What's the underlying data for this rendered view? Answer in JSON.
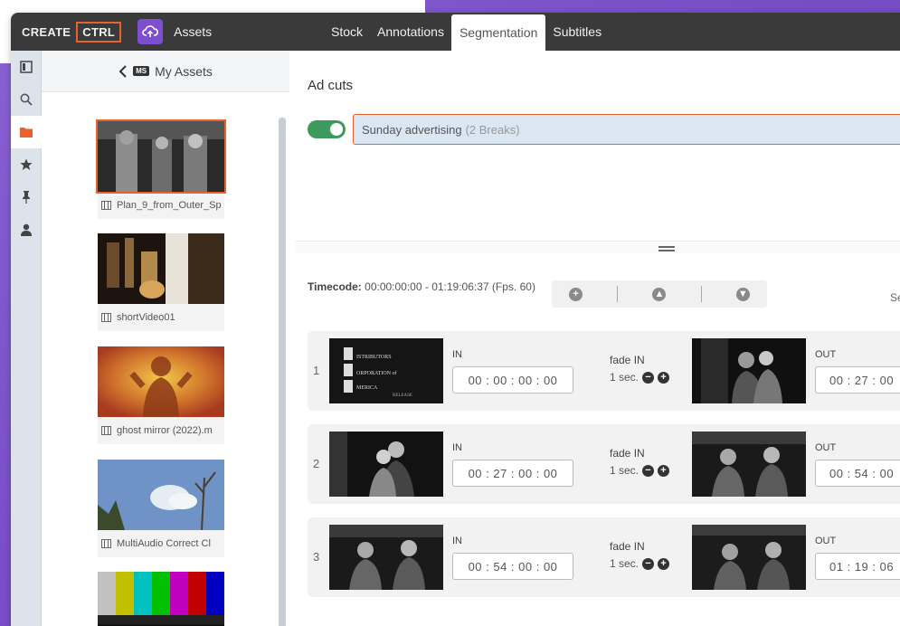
{
  "brand": {
    "create": "CREATE",
    "ctrl": "CTRL"
  },
  "topbar": {
    "assets_label": "Assets"
  },
  "tabs": [
    {
      "label": "Stock"
    },
    {
      "label": "Annotations"
    },
    {
      "label": "Segmentation",
      "active": true
    },
    {
      "label": "Subtitles"
    }
  ],
  "rail": [
    "sidebar-toggle-icon",
    "search-icon",
    "folder-icon",
    "star-icon",
    "pin-icon",
    "user-icon"
  ],
  "assets_panel": {
    "back_label": "My Assets",
    "badge": "MS",
    "items": [
      {
        "name": "Plan_9_from_Outer_Sp"
      },
      {
        "name": "shortVideo01"
      },
      {
        "name": "ghost mirror (2022).m"
      },
      {
        "name": "MultiAudio Correct Cl"
      },
      {
        "name": ""
      }
    ]
  },
  "main": {
    "title": "Ad cuts",
    "selector": {
      "value": "Sunday advertising",
      "meta": "(2 Breaks)"
    },
    "timecode": {
      "label": "Timecode:",
      "value": "00:00:00:00 - 01:19:06:37 (Fps. 60)"
    },
    "cut_label": "Se"
  },
  "segments": [
    {
      "num": "1",
      "in_label": "IN",
      "in": "00 : 00 : 00 : 00",
      "fade_label": "fade IN",
      "fade_value": "1 sec.",
      "out_label": "OUT",
      "out": "00 : 27 : 00"
    },
    {
      "num": "2",
      "in_label": "IN",
      "in": "00 : 27 : 00 : 00",
      "fade_label": "fade IN",
      "fade_value": "1 sec.",
      "out_label": "OUT",
      "out": "00 : 54 : 00"
    },
    {
      "num": "3",
      "in_label": "IN",
      "in": "00 : 54 : 00 : 00",
      "fade_label": "fade IN",
      "fade_value": "1 sec.",
      "out_label": "OUT",
      "out": "01 : 19 : 06"
    }
  ],
  "thumb_text": {
    "line1": "ISTRIBUTORS",
    "line2": "ORPORATION of",
    "line3": "MERICA",
    "line4": "RELEASE"
  },
  "colors": {
    "accent": "#e8622d",
    "brand_purple": "#7d4fd0",
    "toggle_green": "#3b9a5c",
    "topbar": "#3a3a3a"
  }
}
